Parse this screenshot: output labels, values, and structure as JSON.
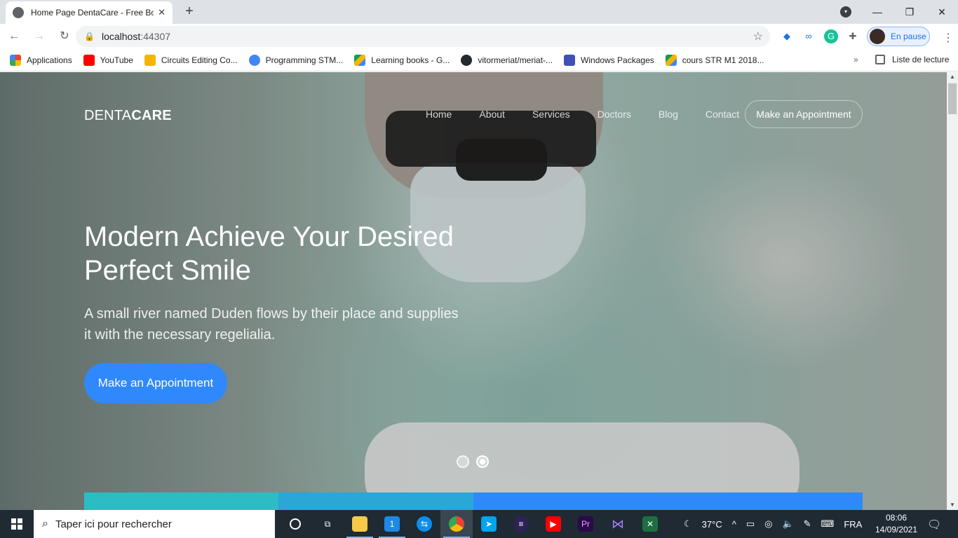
{
  "browser": {
    "tab_title": "Home Page DentaCare - Free Bo",
    "url_host": "localhost",
    "url_port": ":44307",
    "profile_label": "En pause",
    "bookmarks": [
      {
        "label": "Applications",
        "color": "#ea4335"
      },
      {
        "label": "YouTube",
        "color": "#ff0000"
      },
      {
        "label": "Circuits Editing Co...",
        "color": "#f4b400"
      },
      {
        "label": "Programming STM...",
        "color": "#4285f4"
      },
      {
        "label": "Learning books - G...",
        "color": "#0f9d58"
      },
      {
        "label": "vitormeriat/meriat-...",
        "color": "#24292e"
      },
      {
        "label": "Windows Packages",
        "color": "#3f51b5"
      },
      {
        "label": "cours STR M1 2018...",
        "color": "#0f9d58"
      }
    ],
    "reading_list": "Liste de lecture"
  },
  "site": {
    "brand_light": "DENTA",
    "brand_bold": "CARE",
    "nav": [
      "Home",
      "About",
      "Services",
      "Doctors",
      "Blog",
      "Contact"
    ],
    "nav_cta": "Make an Appointment",
    "hero_title": "Modern Achieve Your Desired Perfect Smile",
    "hero_subtitle": "A small river named Duden flows by their place and supplies it with the necessary regelialia.",
    "hero_button": "Make an Appointment",
    "slides_total": 2,
    "slide_active": 2,
    "accent_color": "#2f89fc"
  },
  "taskbar": {
    "search_placeholder": "Taper ici pour rechercher",
    "weather": "37°C",
    "language": "FRA",
    "time": "08:06",
    "date": "14/09/2021",
    "mail_badge": "1"
  }
}
